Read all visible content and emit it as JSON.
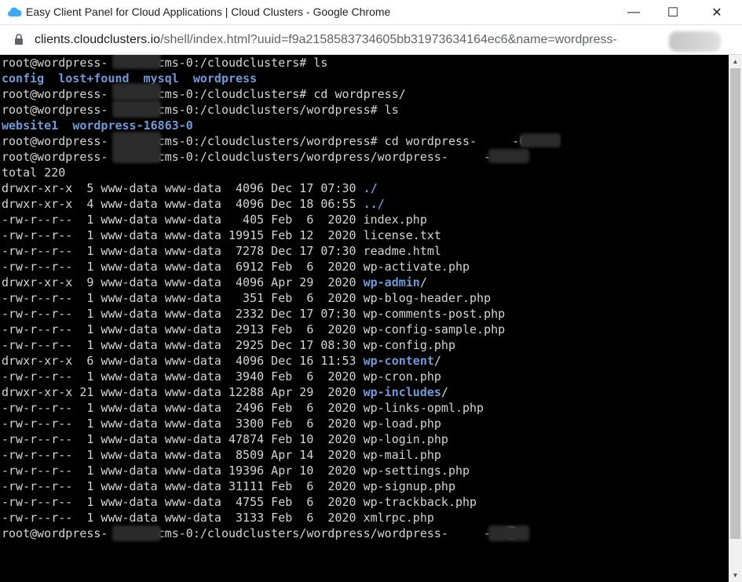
{
  "window": {
    "title": "Easy Client Panel for Cloud Applications | Cloud Clusters - Google Chrome",
    "buttons": {
      "minimize": "—",
      "maximize": "☐",
      "close": "✕"
    }
  },
  "address_bar": {
    "host": "clients.cloudclusters.io",
    "path": "/shell/index.html?uuid=f9a2158583734605bb31973634164ec6&name=wordpress-"
  },
  "terminal": {
    "colors": {
      "background": "#000000",
      "text": "#d4d4d4",
      "directory": "#6f9ad8"
    },
    "lines": [
      [
        {
          "t": "root@wordpress-      -cms-0:/cloudclusters# ls"
        }
      ],
      [
        {
          "t": "config",
          "c": "dir"
        },
        {
          "t": "  "
        },
        {
          "t": "lost+found",
          "c": "dir"
        },
        {
          "t": "  "
        },
        {
          "t": "mysql",
          "c": "dir"
        },
        {
          "t": "  "
        },
        {
          "t": "wordpress",
          "c": "dir"
        }
      ],
      [
        {
          "t": "root@wordpress-      -cms-0:/cloudclusters# cd wordpress/"
        }
      ],
      [
        {
          "t": "root@wordpress-      -cms-0:/cloudclusters/wordpress# ls"
        }
      ],
      [
        {
          "t": "website1",
          "c": "dir"
        },
        {
          "t": "  "
        },
        {
          "t": "wordpress-16863-0",
          "c": "dir"
        }
      ],
      [
        {
          "t": "root@wordpress-      -cms-0:/cloudclusters/wordpress# cd wordpress-     -0/"
        }
      ],
      [
        {
          "t": "root@wordpress-      -cms-0:/cloudclusters/wordpress/wordpress-     -0# ll"
        }
      ],
      [
        {
          "t": "total 220"
        }
      ],
      [
        {
          "t": "drwxr-xr-x  5 www-data www-data  4096 Dec 17 07:30 "
        },
        {
          "t": "./",
          "c": "dir"
        }
      ],
      [
        {
          "t": "drwxr-xr-x  4 www-data www-data  4096 Dec 18 06:55 "
        },
        {
          "t": "../",
          "c": "dir"
        }
      ],
      [
        {
          "t": "-rw-r--r--  1 www-data www-data   405 Feb  6  2020 index.php"
        }
      ],
      [
        {
          "t": "-rw-r--r--  1 www-data www-data 19915 Feb 12  2020 license.txt"
        }
      ],
      [
        {
          "t": "-rw-r--r--  1 www-data www-data  7278 Dec 17 07:30 readme.html"
        }
      ],
      [
        {
          "t": "-rw-r--r--  1 www-data www-data  6912 Feb  6  2020 wp-activate.php"
        }
      ],
      [
        {
          "t": "drwxr-xr-x  9 www-data www-data  4096 Apr 29  2020 "
        },
        {
          "t": "wp-admin",
          "c": "dir"
        },
        {
          "t": "/"
        }
      ],
      [
        {
          "t": "-rw-r--r--  1 www-data www-data   351 Feb  6  2020 wp-blog-header.php"
        }
      ],
      [
        {
          "t": "-rw-r--r--  1 www-data www-data  2332 Dec 17 07:30 wp-comments-post.php"
        }
      ],
      [
        {
          "t": "-rw-r--r--  1 www-data www-data  2913 Feb  6  2020 wp-config-sample.php"
        }
      ],
      [
        {
          "t": "-rw-r--r--  1 www-data www-data  2925 Dec 17 08:30 wp-config.php"
        }
      ],
      [
        {
          "t": "drwxr-xr-x  6 www-data www-data  4096 Dec 16 11:53 "
        },
        {
          "t": "wp-content",
          "c": "dir"
        },
        {
          "t": "/"
        }
      ],
      [
        {
          "t": "-rw-r--r--  1 www-data www-data  3940 Feb  6  2020 wp-cron.php"
        }
      ],
      [
        {
          "t": "drwxr-xr-x 21 www-data www-data 12288 Apr 29  2020 "
        },
        {
          "t": "wp-includes",
          "c": "dir"
        },
        {
          "t": "/"
        }
      ],
      [
        {
          "t": "-rw-r--r--  1 www-data www-data  2496 Feb  6  2020 wp-links-opml.php"
        }
      ],
      [
        {
          "t": "-rw-r--r--  1 www-data www-data  3300 Feb  6  2020 wp-load.php"
        }
      ],
      [
        {
          "t": "-rw-r--r--  1 www-data www-data 47874 Feb 10  2020 wp-login.php"
        }
      ],
      [
        {
          "t": "-rw-r--r--  1 www-data www-data  8509 Apr 14  2020 wp-mail.php"
        }
      ],
      [
        {
          "t": "-rw-r--r--  1 www-data www-data 19396 Apr 10  2020 wp-settings.php"
        }
      ],
      [
        {
          "t": "-rw-r--r--  1 www-data www-data 31111 Feb  6  2020 wp-signup.php"
        }
      ],
      [
        {
          "t": "-rw-r--r--  1 www-data www-data  4755 Feb  6  2020 wp-trackback.php"
        }
      ],
      [
        {
          "t": "-rw-r--r--  1 www-data www-data  3133 Feb  6  2020 xmlrpc.php"
        }
      ],
      [
        {
          "t": "root@wordpress-      -cms-0:/cloudclusters/wordpress/wordpress-     -0#"
        }
      ]
    ]
  }
}
